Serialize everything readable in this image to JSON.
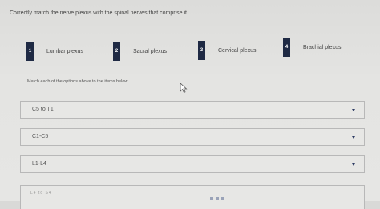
{
  "question": "Correctly match the nerve plexus with the spinal nerves that comprise it.",
  "options": [
    {
      "number": "1",
      "label": "Lumbar plexus"
    },
    {
      "number": "2",
      "label": "Sacral plexus"
    },
    {
      "number": "3",
      "label": "Cervical plexus"
    },
    {
      "number": "4",
      "label": "Brachial plexus"
    }
  ],
  "instruction": "Match each of the options above to the items below.",
  "items": [
    {
      "label": "C5 to T1"
    },
    {
      "label": "C1-C5"
    },
    {
      "label": "L1-L4"
    },
    {
      "label": "L4 to S4"
    }
  ],
  "colors": {
    "badge": "#1f2a44",
    "caret": "#2d3b63",
    "background": "#e4e4e2"
  }
}
